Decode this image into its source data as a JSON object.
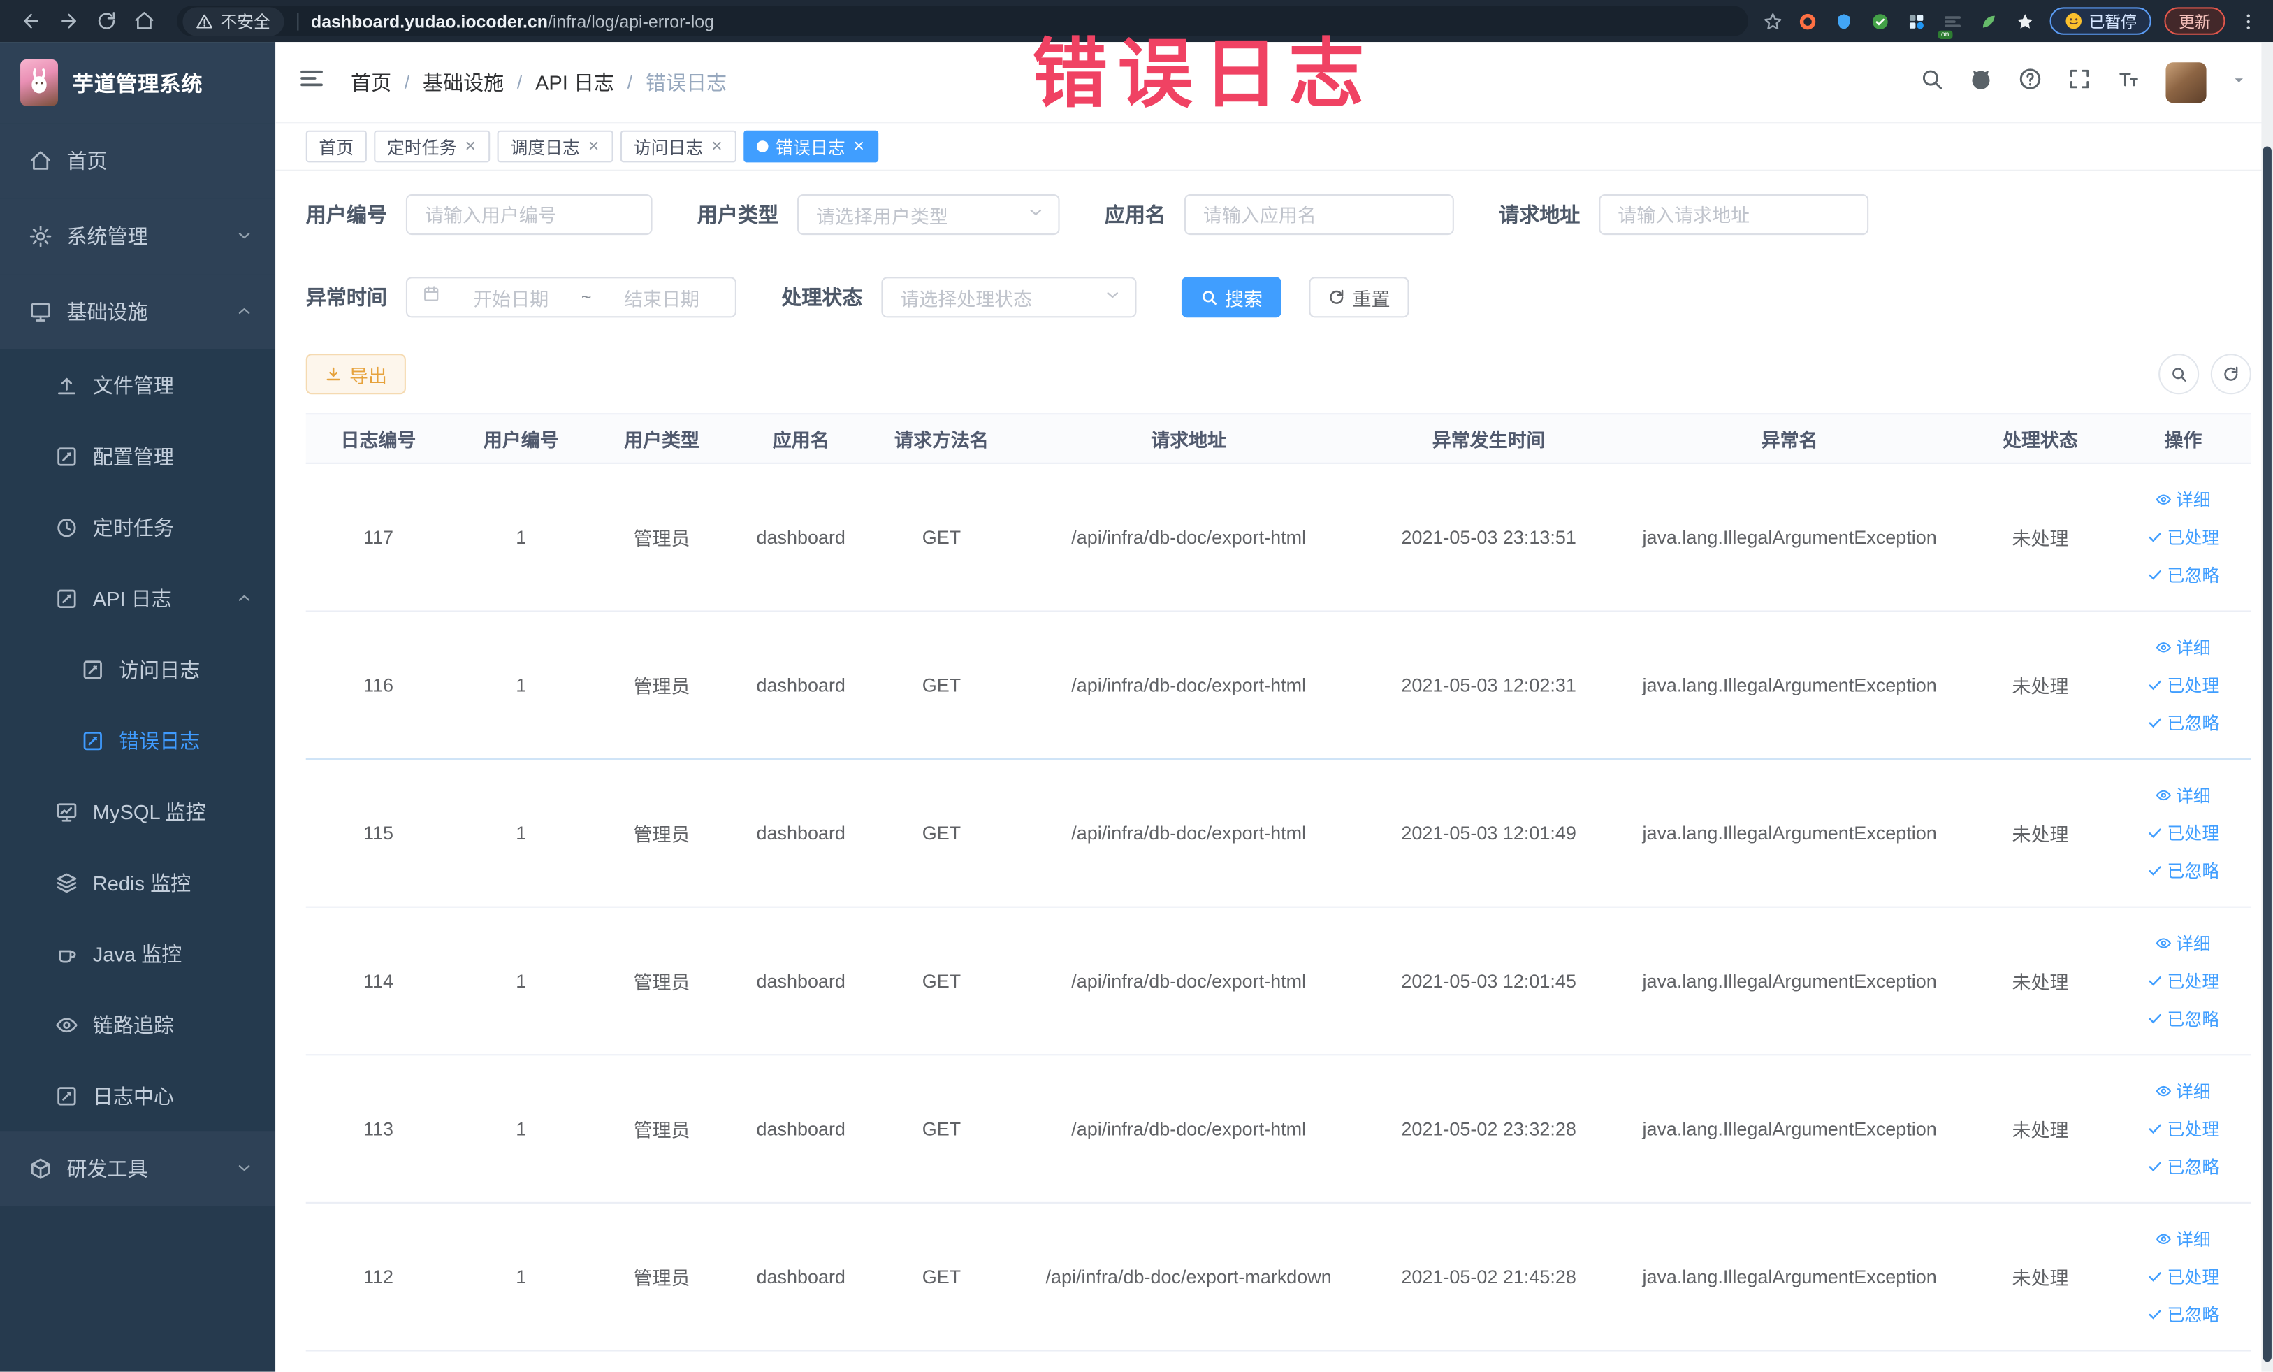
{
  "colors": {
    "accent": "#409eff",
    "warning": "#e6a23c",
    "watermark": "#f04263",
    "sidebar_bg": "#2e4156",
    "chrome_bg": "#1e2936"
  },
  "browser": {
    "security_label": "不安全",
    "url_host": "dashboard.yudao.iocoder.cn",
    "url_path": "/infra/log/api-error-log",
    "paused_badge": "已暂停",
    "update_badge": "更新"
  },
  "watermark": "错误日志",
  "sidebar": {
    "logo_title": "芋道管理系统",
    "items": [
      {
        "label": "首页"
      },
      {
        "label": "系统管理"
      },
      {
        "label": "基础设施"
      },
      {
        "label": "文件管理"
      },
      {
        "label": "配置管理"
      },
      {
        "label": "定时任务"
      },
      {
        "label": "API 日志"
      },
      {
        "label": "访问日志"
      },
      {
        "label": "错误日志"
      },
      {
        "label": "MySQL 监控"
      },
      {
        "label": "Redis 监控"
      },
      {
        "label": "Java 监控"
      },
      {
        "label": "链路追踪"
      },
      {
        "label": "日志中心"
      },
      {
        "label": "研发工具"
      }
    ]
  },
  "header": {
    "breadcrumb": [
      "首页",
      "基础设施",
      "API 日志",
      "错误日志"
    ]
  },
  "tabs": [
    {
      "label": "首页"
    },
    {
      "label": "定时任务"
    },
    {
      "label": "调度日志"
    },
    {
      "label": "访问日志"
    },
    {
      "label": "错误日志"
    }
  ],
  "filters": {
    "user_id": {
      "label": "用户编号",
      "placeholder": "请输入用户编号"
    },
    "user_type": {
      "label": "用户类型",
      "placeholder": "请选择用户类型"
    },
    "app_name": {
      "label": "应用名",
      "placeholder": "请输入应用名"
    },
    "request_url": {
      "label": "请求地址",
      "placeholder": "请输入请求地址"
    },
    "exception_time": {
      "label": "异常时间",
      "start_placeholder": "开始日期",
      "separator": "~",
      "end_placeholder": "结束日期"
    },
    "process_status": {
      "label": "处理状态",
      "placeholder": "请选择处理状态"
    },
    "search_button": "搜索",
    "reset_button": "重置"
  },
  "toolbar": {
    "export_button": "导出"
  },
  "table": {
    "headers": [
      "日志编号",
      "用户编号",
      "用户类型",
      "应用名",
      "请求方法名",
      "请求地址",
      "异常发生时间",
      "异常名",
      "处理状态",
      "操作"
    ],
    "row_actions": [
      "详细",
      "已处理",
      "已忽略"
    ],
    "rows": [
      {
        "id": "117",
        "user_id": "1",
        "user_type": "管理员",
        "app": "dashboard",
        "method": "GET",
        "url": "/api/infra/db-doc/export-html",
        "time": "2021-05-03 23:13:51",
        "exception": "java.lang.IllegalArgumentException",
        "status": "未处理"
      },
      {
        "id": "116",
        "user_id": "1",
        "user_type": "管理员",
        "app": "dashboard",
        "method": "GET",
        "url": "/api/infra/db-doc/export-html",
        "time": "2021-05-03 12:02:31",
        "exception": "java.lang.IllegalArgumentException",
        "status": "未处理"
      },
      {
        "id": "115",
        "user_id": "1",
        "user_type": "管理员",
        "app": "dashboard",
        "method": "GET",
        "url": "/api/infra/db-doc/export-html",
        "time": "2021-05-03 12:01:49",
        "exception": "java.lang.IllegalArgumentException",
        "status": "未处理"
      },
      {
        "id": "114",
        "user_id": "1",
        "user_type": "管理员",
        "app": "dashboard",
        "method": "GET",
        "url": "/api/infra/db-doc/export-html",
        "time": "2021-05-03 12:01:45",
        "exception": "java.lang.IllegalArgumentException",
        "status": "未处理"
      },
      {
        "id": "113",
        "user_id": "1",
        "user_type": "管理员",
        "app": "dashboard",
        "method": "GET",
        "url": "/api/infra/db-doc/export-html",
        "time": "2021-05-02 23:32:28",
        "exception": "java.lang.IllegalArgumentException",
        "status": "未处理"
      },
      {
        "id": "112",
        "user_id": "1",
        "user_type": "管理员",
        "app": "dashboard",
        "method": "GET",
        "url": "/api/infra/db-doc/export-markdown",
        "time": "2021-05-02 21:45:28",
        "exception": "java.lang.IllegalArgumentException",
        "status": "未处理"
      }
    ]
  }
}
